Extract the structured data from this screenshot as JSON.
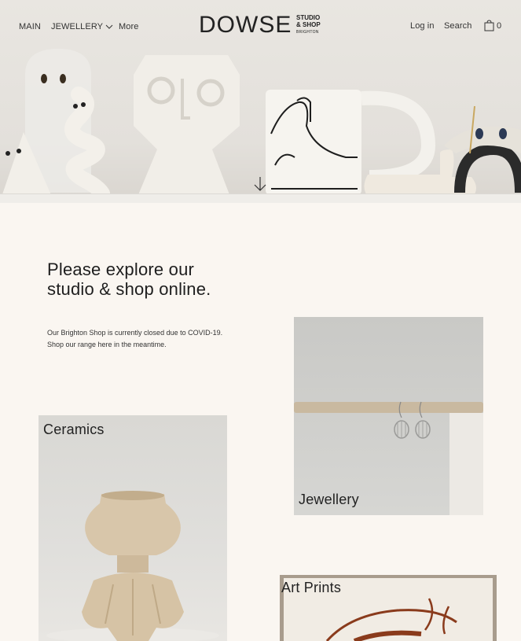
{
  "nav": {
    "main": "MAIN",
    "jewellery": "JEWELLERY",
    "more": "More",
    "login": "Log in",
    "search": "Search",
    "cart_count": "0"
  },
  "logo": {
    "word": "DOWSE",
    "line1": "STUDIO",
    "line2": "& SHOP",
    "line3": "BRIGHTON"
  },
  "intro": {
    "title": "Please explore our studio & shop online.",
    "text": "Our Brighton Shop is currently closed due to COVID-19. Shop our range here in the meantime."
  },
  "collections": [
    {
      "label": "Ceramics"
    },
    {
      "label": "Jewellery"
    },
    {
      "label": "Art Prints"
    }
  ],
  "icons": {
    "chevron": "chevron-down-icon",
    "cart": "shopping-bag-icon",
    "scroll": "arrow-down-icon"
  }
}
